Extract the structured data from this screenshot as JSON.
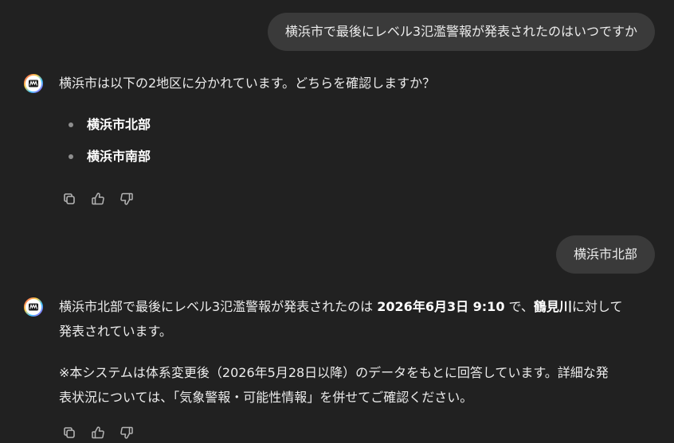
{
  "conversation": {
    "user_message_1": "横浜市で最後にレベル3氾濫警報が発表されたのはいつですか",
    "assistant_message_1": {
      "text": "横浜市は以下の2地区に分かれています。どちらを確認しますか？",
      "options": [
        "横浜市北部",
        "横浜市南部"
      ]
    },
    "user_message_2": "横浜市北部",
    "assistant_message_2": {
      "part1": "横浜市北部で最後にレベル3氾濫警報が発表されたのは ",
      "date_strong": "2026年6月3日 9:10",
      "part2": " で、",
      "river_strong": "鶴見川",
      "part3": "に対して",
      "line2": "発表されています。",
      "note_line1": "※本システムは体系変更後（2026年5月28日以降）のデータをもとに回答しています。詳細な発",
      "note_line2": "表状況については、「気象警報・可能性情報」を併せてご確認ください。"
    }
  },
  "actions": {
    "icons": [
      "copy-icon",
      "thumbs-up-icon",
      "thumbs-down-icon"
    ]
  },
  "colors": {
    "background": "#212121",
    "user_bubble": "#3a3a3a",
    "text": "#ececec",
    "bullet": "#8e8e8e"
  }
}
